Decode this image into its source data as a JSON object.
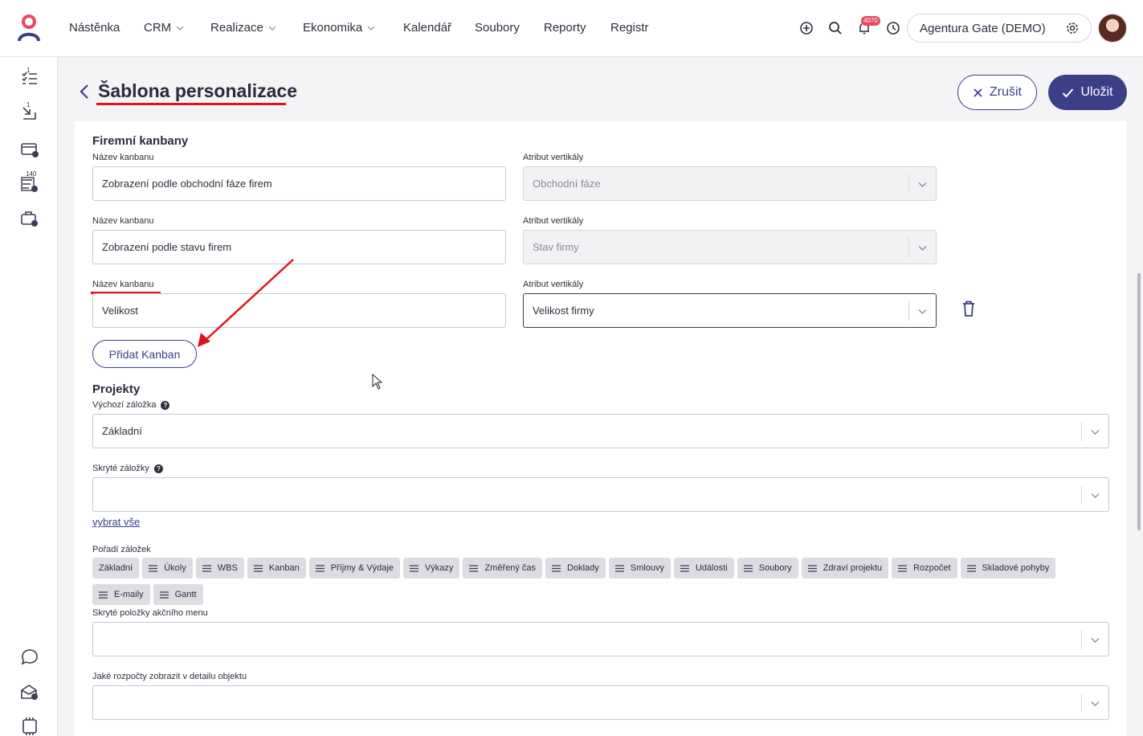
{
  "nav": {
    "items": [
      {
        "label": "Nástěnka",
        "dropdown": false
      },
      {
        "label": "CRM",
        "dropdown": true
      },
      {
        "label": "Realizace",
        "dropdown": true
      },
      {
        "label": "Ekonomika",
        "dropdown": true
      },
      {
        "label": "Kalendář",
        "dropdown": false
      },
      {
        "label": "Soubory",
        "dropdown": false
      },
      {
        "label": "Reporty",
        "dropdown": false
      },
      {
        "label": "Registr",
        "dropdown": false
      }
    ],
    "notifications_count": "4070",
    "company": "Agentura Gate (DEMO)",
    "icons": [
      "add-circle-icon",
      "search-icon",
      "bell-icon",
      "history-icon",
      "gear-icon"
    ]
  },
  "sidebar": {
    "icons": [
      "task-list-icon",
      "inbox-arrow-icon",
      "card-alert-icon",
      "timesheet-alert-icon",
      "briefcase-clock-icon",
      "chat-icon",
      "mail-settings-icon",
      "ai-chip-icon"
    ],
    "badges": [
      "1",
      "1",
      "140"
    ]
  },
  "header": {
    "title": "Šablona personalizace",
    "cancel_label": "Zrušit",
    "save_label": "Uložit"
  },
  "kanbans": {
    "section_title": "Firemní kanbany",
    "name_label": "Název kanbanu",
    "attr_label": "Atribut vertikály",
    "rows": [
      {
        "name": "Zobrazení podle obchodní fáze firem",
        "attr": "Obchodní fáze",
        "disabled": true
      },
      {
        "name": "Zobrazení podle stavu firem",
        "attr": "Stav firmy",
        "disabled": true
      },
      {
        "name": "Velikost",
        "attr": "Velikost firmy",
        "disabled": false
      }
    ],
    "add_label": "Přidat Kanban"
  },
  "projects": {
    "section_title": "Projekty",
    "default_tab_label": "Výchozí záložka",
    "default_tab_value": "Základní",
    "hidden_tabs_label": "Skryté záložky",
    "hidden_tabs_value": "",
    "select_all_label": "vybrat vše",
    "order_label": "Pořadí záložek",
    "tabs_order": [
      "Základní",
      "Úkoly",
      "WBS",
      "Kanban",
      "Příjmy & Výdaje",
      "Výkazy",
      "Změřený čas",
      "Doklady",
      "Smlouvy",
      "Události",
      "Soubory",
      "Zdraví projektu",
      "Rozpočet",
      "Skladové pohyby",
      "E-maily",
      "Gantt"
    ],
    "hidden_actions_label": "Skryté položky akčního menu",
    "hidden_actions_value": "",
    "budgets_label": "Jaké rozpočty zobrazit v detailu objektu",
    "budgets_value": ""
  },
  "colors": {
    "primary": "#3b3f88",
    "annotation": "#e0141e",
    "badge": "#e84a5f"
  }
}
